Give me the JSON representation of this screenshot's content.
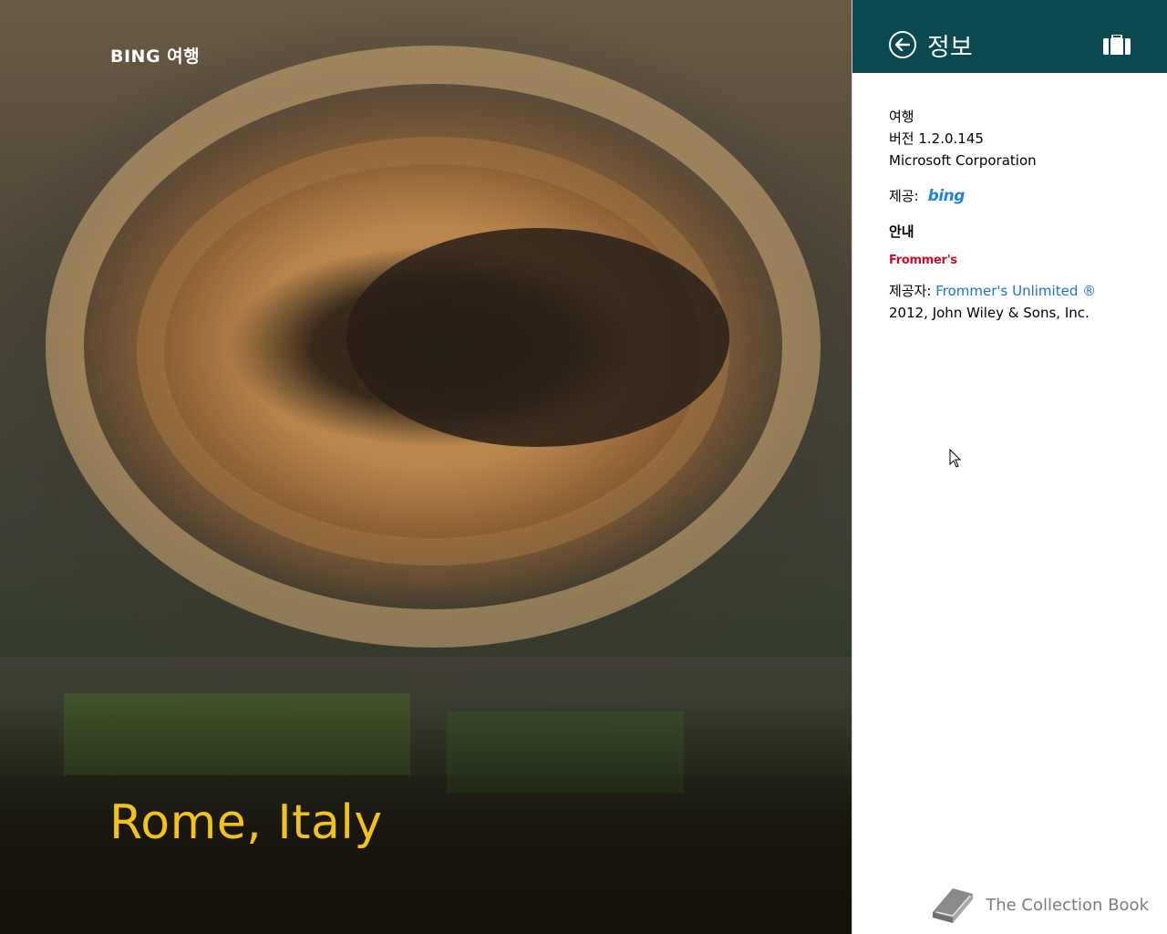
{
  "hero": {
    "brand": "BING 여행",
    "place": "Rome, Italy"
  },
  "panel": {
    "title": "정보",
    "app_name": "여행",
    "version": "버전 1.2.0.145",
    "publisher": "Microsoft Corporation",
    "provided_by_label": "제공:",
    "provided_by_logo": "bing",
    "guide_heading": "안내",
    "guide_logo": "Frommer's",
    "credit_prefix": "제공자: ",
    "credit_link": "Frommer's Unlimited ®",
    "credit_suffix": " 2012, John Wiley & Sons, Inc."
  },
  "watermark": {
    "text": "The Collection Book"
  },
  "colors": {
    "header_bg": "#0b4950",
    "place_text": "#f2c21b",
    "link": "#1a73c9",
    "bing": "#1f87d6",
    "frommers": "#c8102e"
  },
  "icons": {
    "back": "back-arrow-circle-icon",
    "app": "suitcase-icon",
    "watermark": "book-icon",
    "cursor": "mouse-pointer-icon"
  }
}
